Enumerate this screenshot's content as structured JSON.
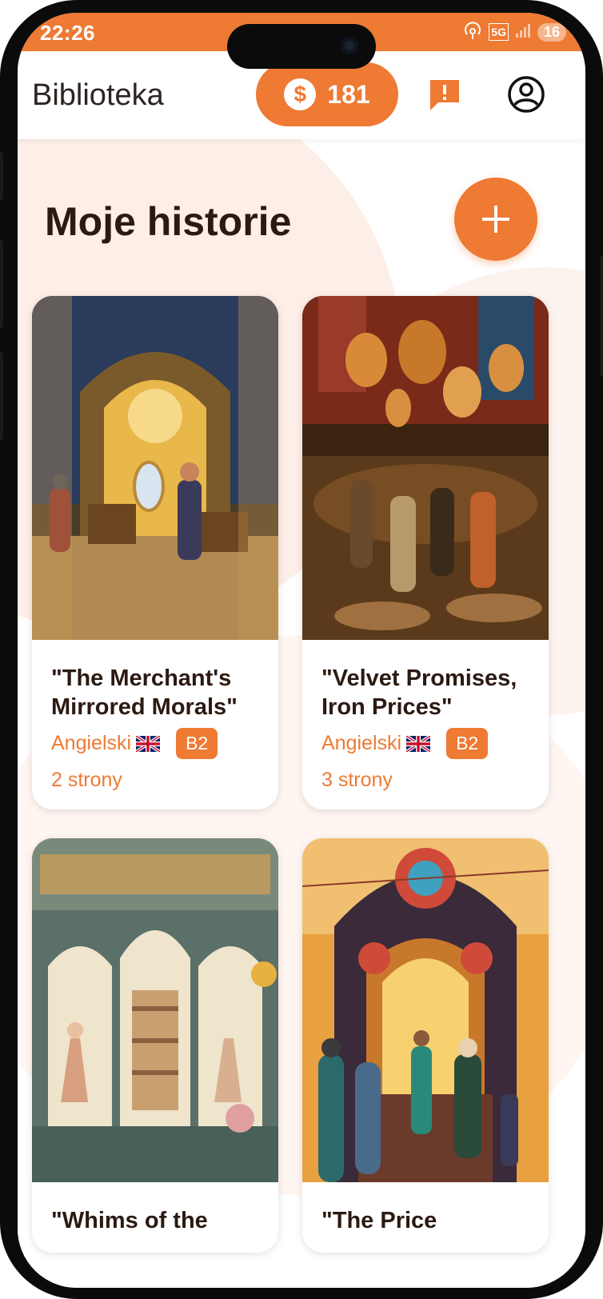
{
  "status_bar": {
    "time": "22:26",
    "network": "5G",
    "battery": "16",
    "icons": [
      "hotspot-icon",
      "5g-icon",
      "signal-icon",
      "battery-icon"
    ]
  },
  "app_bar": {
    "title": "Biblioteka",
    "coins": "181",
    "coin_icon": "$",
    "actions": [
      "feedback-icon",
      "profile-icon"
    ]
  },
  "main": {
    "section_title": "Moje historie",
    "add_icon": "plus-icon",
    "stories": [
      {
        "title": "\"The Merchant's Mirrored Morals\"",
        "language": "Angielski",
        "level": "B2",
        "pages": "2 strony"
      },
      {
        "title": "\"Velvet Promises, Iron Prices\"",
        "language": "Angielski",
        "level": "B2",
        "pages": "3 strony"
      },
      {
        "title": "\"Whims of the",
        "language": "",
        "level": "",
        "pages": ""
      },
      {
        "title": "\"The Price",
        "language": "",
        "level": "",
        "pages": ""
      }
    ]
  },
  "colors": {
    "accent": "#ee7a33",
    "text_dark": "#2b1a12",
    "blob": "#fdeee7"
  }
}
